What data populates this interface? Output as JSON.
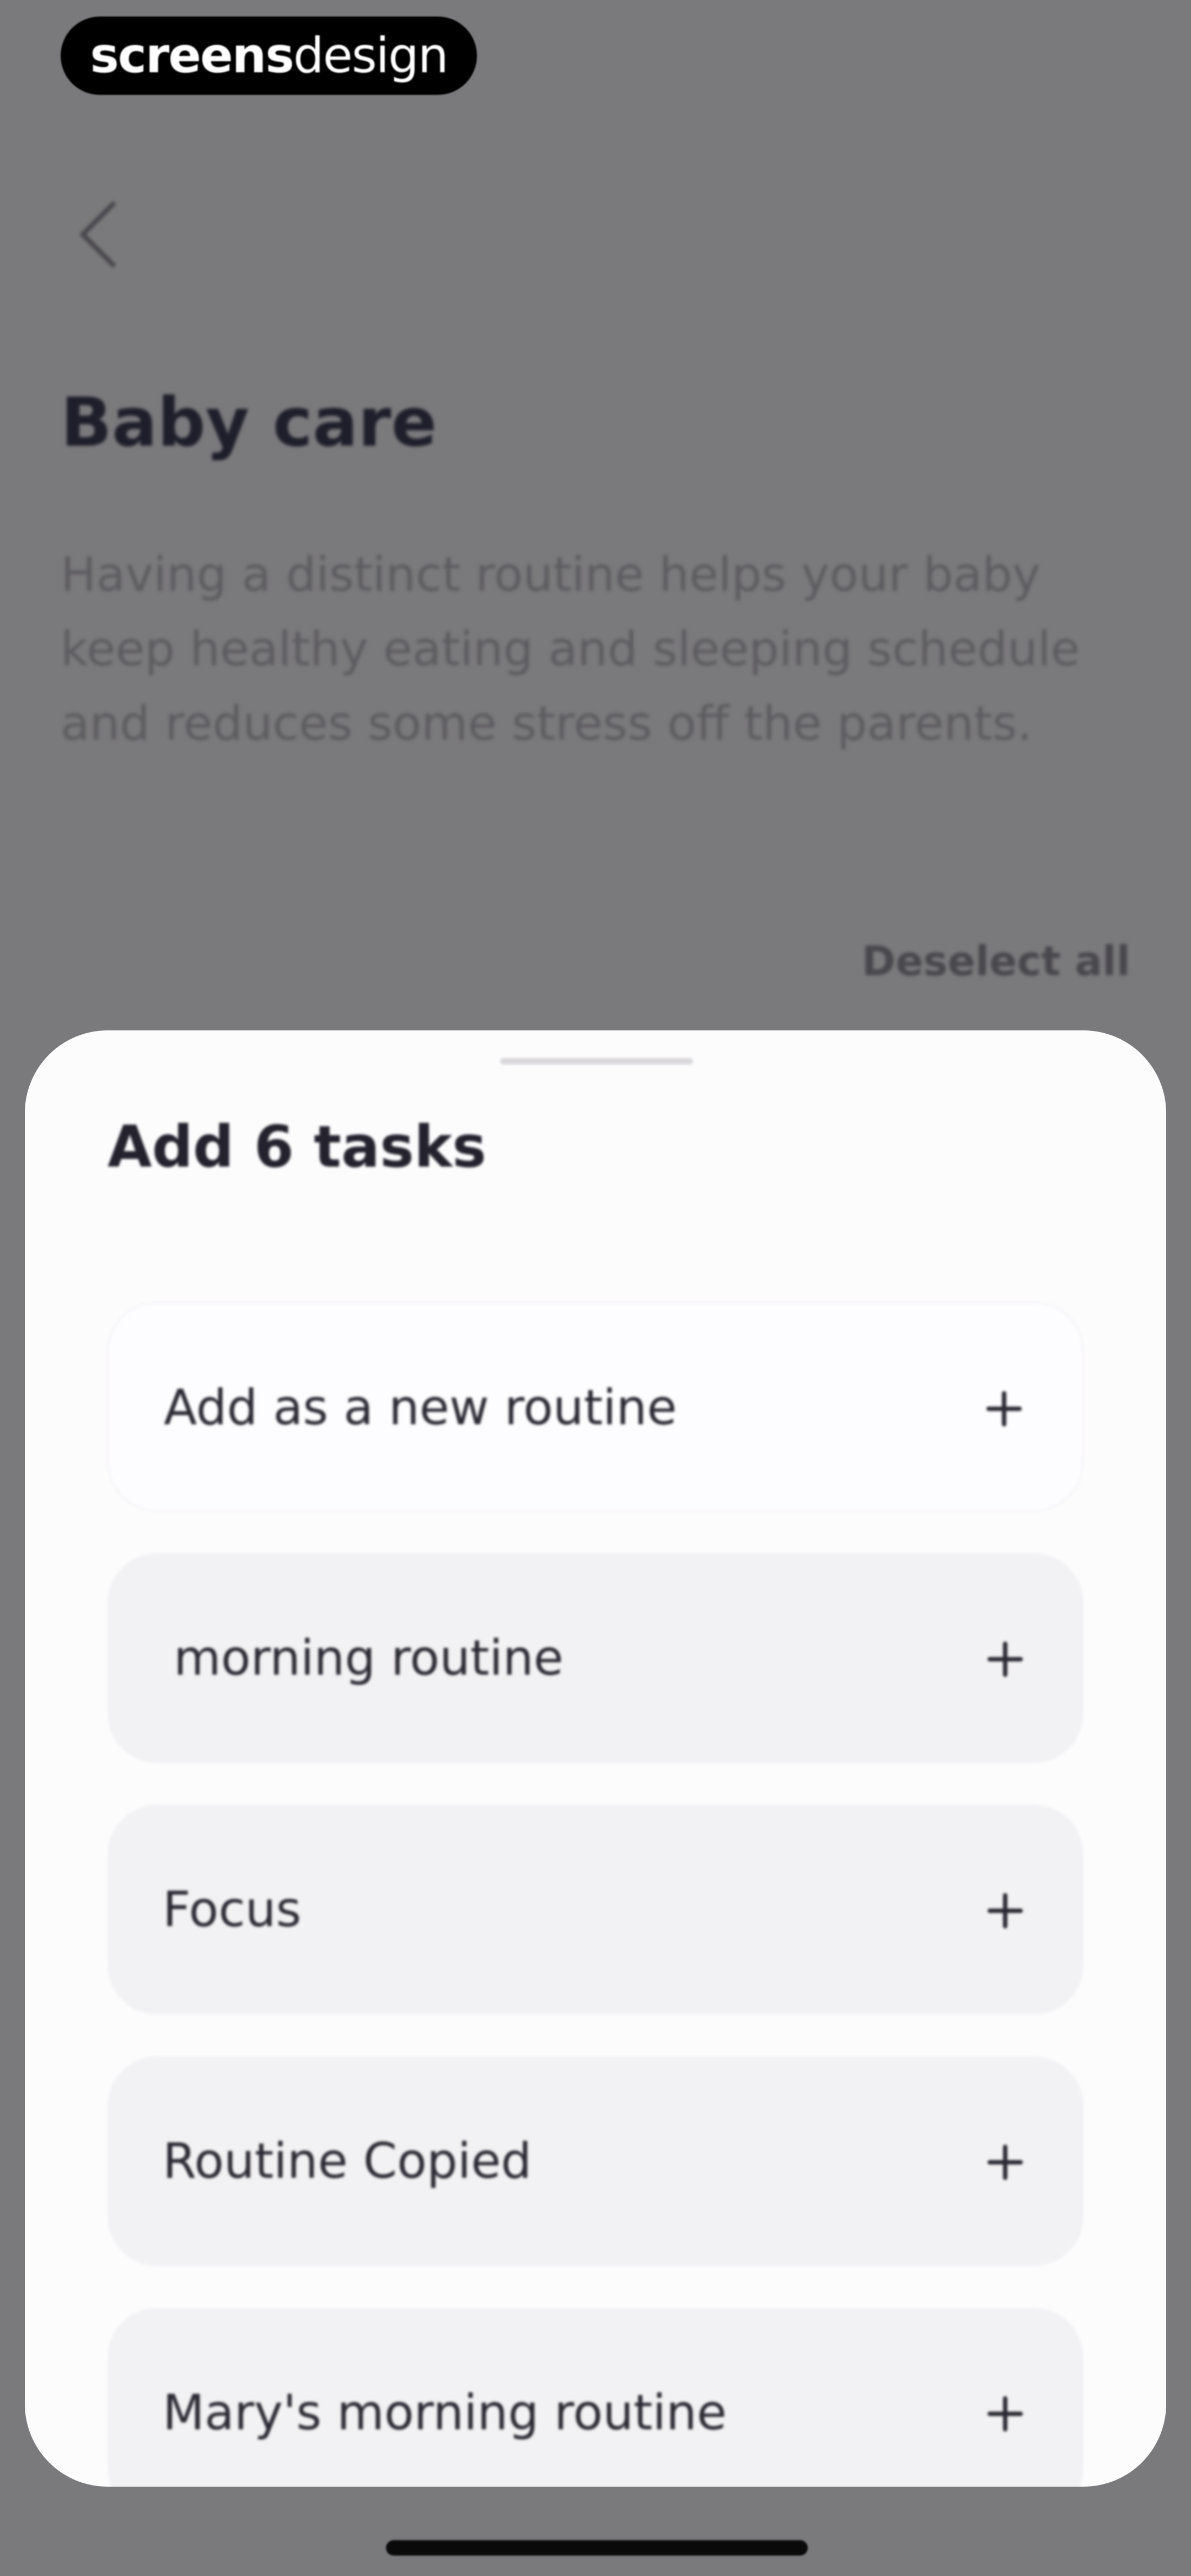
{
  "watermark": {
    "bold": "screens",
    "light": "design"
  },
  "header": {
    "back_icon": "chevron-left-icon",
    "title": "Baby care",
    "description": "Having a distinct routine helps your baby keep healthy eating and sleeping schedule and reduces some stress off the parents.",
    "deselect_label": "Deselect all"
  },
  "sheet": {
    "title": "Add 6 tasks",
    "options": [
      {
        "label": "Add as a new routine",
        "icon": "plus-icon"
      },
      {
        "label": " morning routine",
        "icon": "plus-icon"
      },
      {
        "label": "Focus",
        "icon": "plus-icon"
      },
      {
        "label": "Routine Copied",
        "icon": "plus-icon"
      },
      {
        "label": "Mary's morning routine",
        "icon": "plus-icon"
      }
    ]
  },
  "colors": {
    "scrim": "#7a797c",
    "sheet_bg": "#fdfcfd",
    "option_bg": "#f2f1f3",
    "text_dark": "#23222d"
  }
}
